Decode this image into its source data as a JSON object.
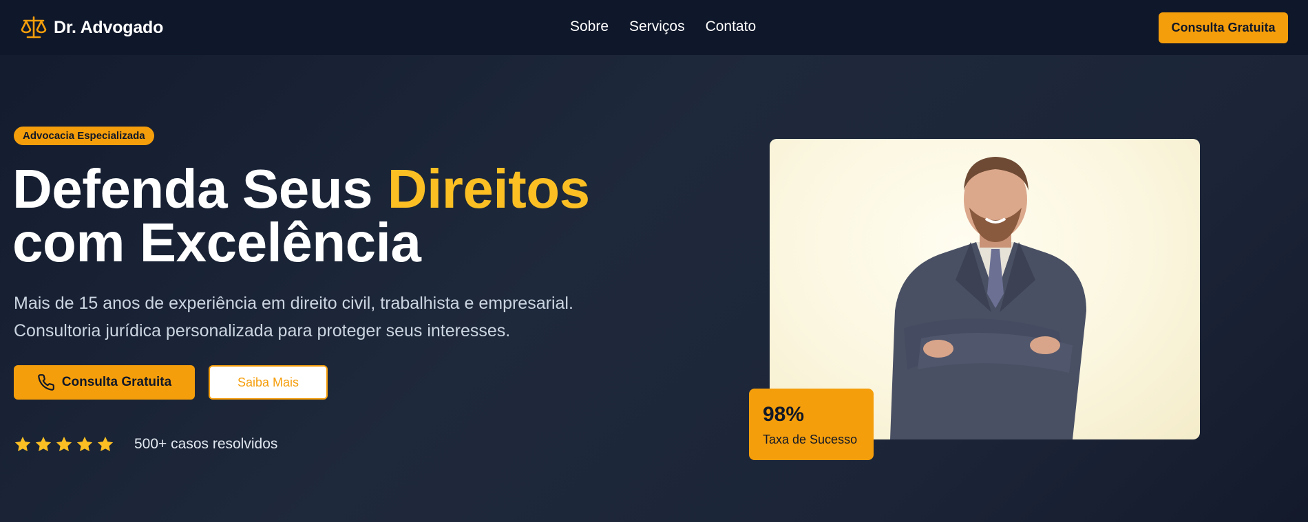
{
  "brand": {
    "name": "Dr. Advogado",
    "icon": "scales-icon",
    "accent_color": "#f59e0b",
    "highlight_color": "#fbbf24",
    "nav_bg": "#0f172a",
    "hero_bg": "#1e293b"
  },
  "nav": {
    "links": [
      "Sobre",
      "Serviços",
      "Contato"
    ],
    "cta_label": "Consulta Gratuita"
  },
  "hero": {
    "badge": "Advocacia Especializada",
    "headline_part1": "Defenda Seus ",
    "headline_accent": "Direitos",
    "headline_part2": "com Excelência",
    "subtitle_line1": "Mais de 15 anos de experiência em direito civil, trabalhista e empresarial.",
    "subtitle_line2": "Consultoria jurídica personalizada para proteger seus interesses.",
    "primary_button": "Consulta Gratuita",
    "primary_button_icon": "phone-icon",
    "secondary_button": "Saiba Mais",
    "rating_stars": 5,
    "cases_text": "500+ casos resolvidos"
  },
  "media": {
    "photo": "lawyer-portrait",
    "stat_value": "98%",
    "stat_label": "Taxa de Sucesso"
  }
}
